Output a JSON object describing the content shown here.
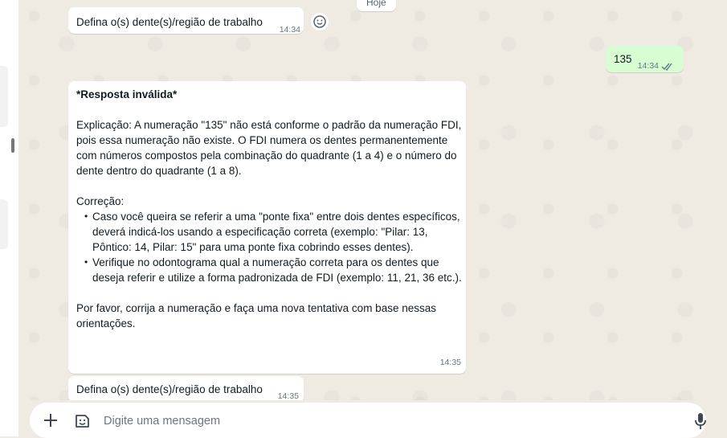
{
  "date_label": "Hoje",
  "messages": [
    {
      "text": "Defina o(s) dente(s)/região de trabalho",
      "time": "14:34"
    },
    {
      "text": "135",
      "time": "14:34"
    },
    {
      "title": "*Resposta inválida*",
      "explanation": "Explicação: A numeração \"135\" não está conforme o padrão da numeração FDI, pois essa numeração não existe. O FDI numera os dentes permanentemente com números compostos pela combinação do quadrante (1 a 4) e o número do dente dentro do quadrante (1 a 8).",
      "correction_label": "Correção:",
      "bullets": [
        "Caso você queira se referir a uma \"ponte fixa\" entre dois dentes específicos, deverá indicá-los usando a especificação correta (exemplo: \"Pilar: 13, Pôntico: 14, Pilar: 15\" para uma ponte fixa cobrindo esses dentes).",
        "Verifique no odontograma qual a numeração correta para os dentes que deseja referir e utilize a forma padronizada de FDI (exemplo: 11, 21, 36 etc.)."
      ],
      "closing": "Por favor, corrija a numeração e faça uma nova tentativa com base nessas orientações.",
      "time": "14:35"
    },
    {
      "text": "Defina o(s) dente(s)/região de trabalho",
      "time": "14:35"
    }
  ],
  "composer": {
    "placeholder": "Digite uma mensagem"
  },
  "colors": {
    "incoming": "#ffffff",
    "outgoing": "#d9fdd3",
    "background": "#efeae2",
    "read_ticks": "#667781"
  },
  "icons": [
    "emoji-icon",
    "double-check-icon",
    "plus-icon",
    "sticker-icon",
    "mic-icon"
  ]
}
